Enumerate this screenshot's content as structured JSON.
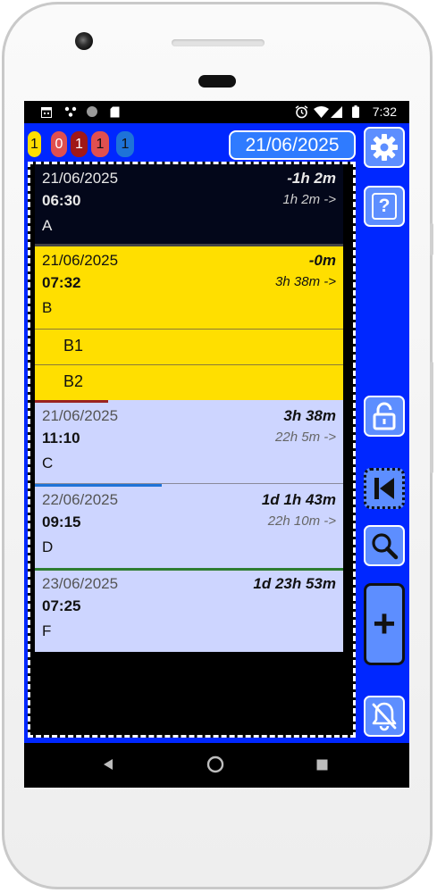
{
  "status_bar": {
    "time": "7:32",
    "left_icons": [
      "calendar-icon",
      "dots-icon",
      "circle-icon",
      "sd-card-icon"
    ],
    "right_icons": [
      "alarm-icon",
      "wifi-icon",
      "signal-icon",
      "battery-icon"
    ]
  },
  "counters": [
    {
      "value": "1",
      "color": "#ffdf00",
      "text_color": "#111111"
    },
    {
      "value": "0",
      "color": "#e05050",
      "text_color": "#ffffff"
    },
    {
      "value": "1",
      "color": "#a01818",
      "text_color": "#ffffff"
    },
    {
      "value": "1",
      "color": "#e05050",
      "text_color": "#111111"
    },
    {
      "value": "1",
      "color": "#1e73d8",
      "text_color": "#111111"
    }
  ],
  "current_date": "21/06/2025",
  "entries": [
    {
      "date": "21/06/2025",
      "time": "06:30",
      "name": "A",
      "relative": "-1h 2m",
      "duration": "1h 2m ->",
      "bg": "#03071a",
      "fg": "#e8e8e8"
    },
    {
      "date": "21/06/2025",
      "time": "07:32",
      "name": "B",
      "relative": "-0m",
      "duration": "3h 38m ->",
      "bg": "#ffdf00",
      "fg": "#111111",
      "subitems": [
        "B1",
        "B2"
      ]
    },
    {
      "date": "21/06/2025",
      "time": "11:10",
      "name": "C",
      "relative": "3h 38m",
      "duration": "22h 5m ->",
      "bg": "#cdd5ff",
      "fg": "#111111"
    },
    {
      "date": "22/06/2025",
      "time": "09:15",
      "name": "D",
      "relative": "1d 1h 43m",
      "duration": "22h 10m ->",
      "bg": "#cdd5ff",
      "fg": "#111111"
    },
    {
      "date": "23/06/2025",
      "time": "07:25",
      "name": "F",
      "relative": "1d 23h 53m",
      "duration": "",
      "bg": "#cdd5ff",
      "fg": "#111111"
    }
  ],
  "right_buttons": [
    "settings-gear",
    "help",
    "unlock",
    "skip-to-start",
    "search",
    "add",
    "notifications-off"
  ],
  "help_label": "?",
  "add_label": "+",
  "colors": {
    "app_bg": "#0027ff",
    "button_bg": "#5d8eff",
    "date_bg": "#2f7bff",
    "divider_red": "#9a2222",
    "divider_blue": "#1e73d8",
    "divider_green": "#2e7d32"
  }
}
